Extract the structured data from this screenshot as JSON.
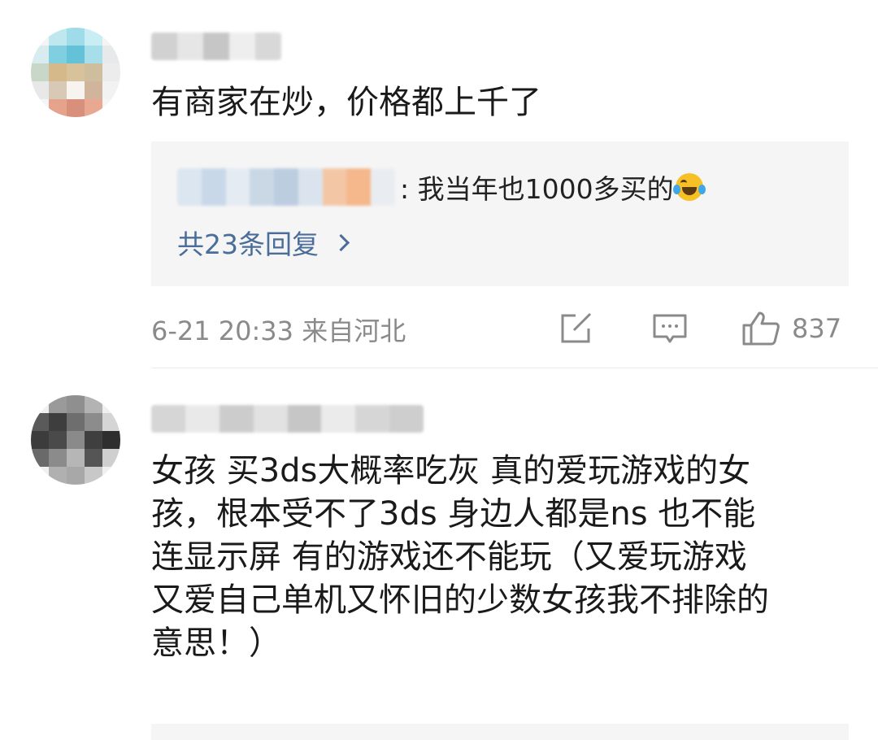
{
  "comments": [
    {
      "text": "有商家在炒，价格都上千了",
      "reply": {
        "text": ": 我当年也1000多买的",
        "emoji": "laugh-cry-emoji"
      },
      "reply_count_label": "共23条回复",
      "meta": "6-21 20:33 来自河北",
      "like_count": "837"
    },
    {
      "text": "女孩 买3ds大概率吃灰 真的爱玩游戏的女\n孩，根本受不了3ds 身边人都是ns 也不能\n连显示屏 有的游戏还不能玩（又爱玩游戏\n又爱自己单机又怀旧的少数女孩我不排除的\n意思！）"
    }
  ],
  "colors": {
    "link": "#4a6d99",
    "meta": "#8a8a8a",
    "reply_bg": "#f5f5f5"
  },
  "icons": [
    "share-icon",
    "comment-icon",
    "thumbs-up-icon",
    "chevron-right-icon"
  ]
}
